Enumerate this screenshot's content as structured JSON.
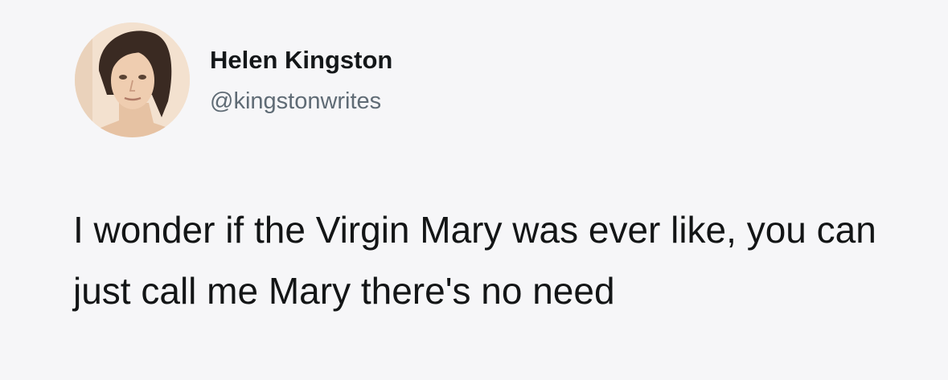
{
  "tweet": {
    "author": {
      "display_name": "Helen Kingston",
      "handle": "@kingstonwrites",
      "avatar_icon": "profile-photo"
    },
    "text": "I wonder if the Virgin Mary was ever like, you can just call me Mary there's no need"
  },
  "colors": {
    "background": "#f6f6f8",
    "name_text": "#141719",
    "handle_text": "#5f6b75",
    "body_text": "#131516"
  }
}
